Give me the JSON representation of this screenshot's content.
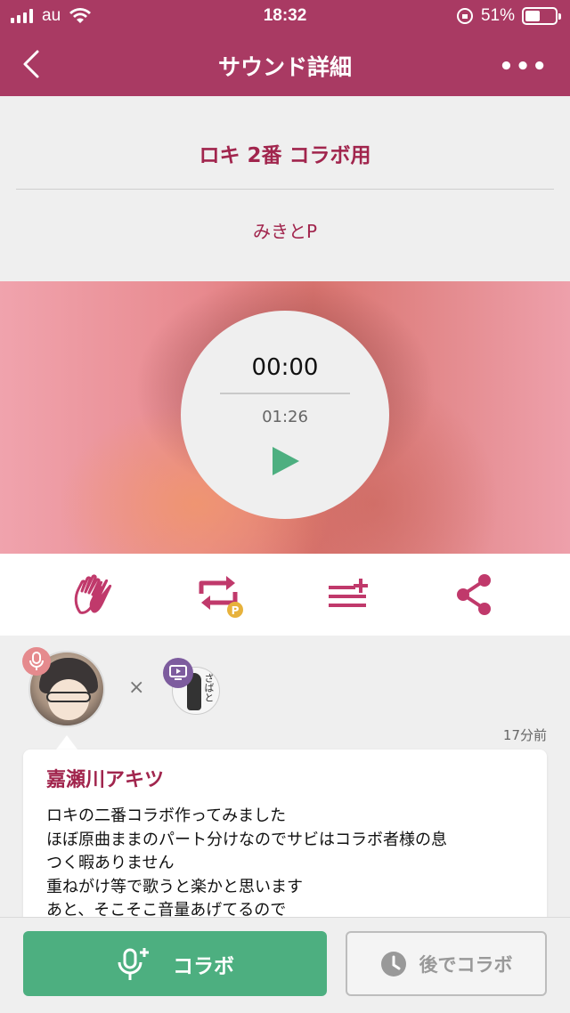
{
  "status_bar": {
    "carrier": "au",
    "time": "18:32",
    "battery_percent_label": "51%",
    "battery_level": 0.51
  },
  "nav": {
    "title": "サウンド詳細",
    "more_label": "•••"
  },
  "sound": {
    "title": "ロキ 2番 コラボ用",
    "artist": "みきとP"
  },
  "player": {
    "current_time": "00:00",
    "total_time": "01:26"
  },
  "actions": [
    {
      "icon": "clap-icon"
    },
    {
      "icon": "repost-icon",
      "badge": "P"
    },
    {
      "icon": "add-to-playlist-icon"
    },
    {
      "icon": "share-icon"
    }
  ],
  "collab": {
    "posted_ago": "17分前",
    "user_name": "嘉瀬川アキツ",
    "description_lines": [
      "ロキの二番コラボ作ってみました",
      "ほぼ原曲ままのパート分けなのでサビはコラボ者様の息",
      "つく暇ありません",
      "重ねがけ等で歌うと楽かと思います",
      "あと、そこそこ音量あげてるので"
    ],
    "cross_symbol": "×",
    "partner_avatar_text": "ざばと"
  },
  "bottom": {
    "collab_button": "コラボ",
    "later_button": "後でコラボ"
  },
  "colors": {
    "brand": "#a93a63",
    "accent_text": "#a1254d",
    "green": "#4daf80",
    "icon_pink": "#c0396b"
  }
}
